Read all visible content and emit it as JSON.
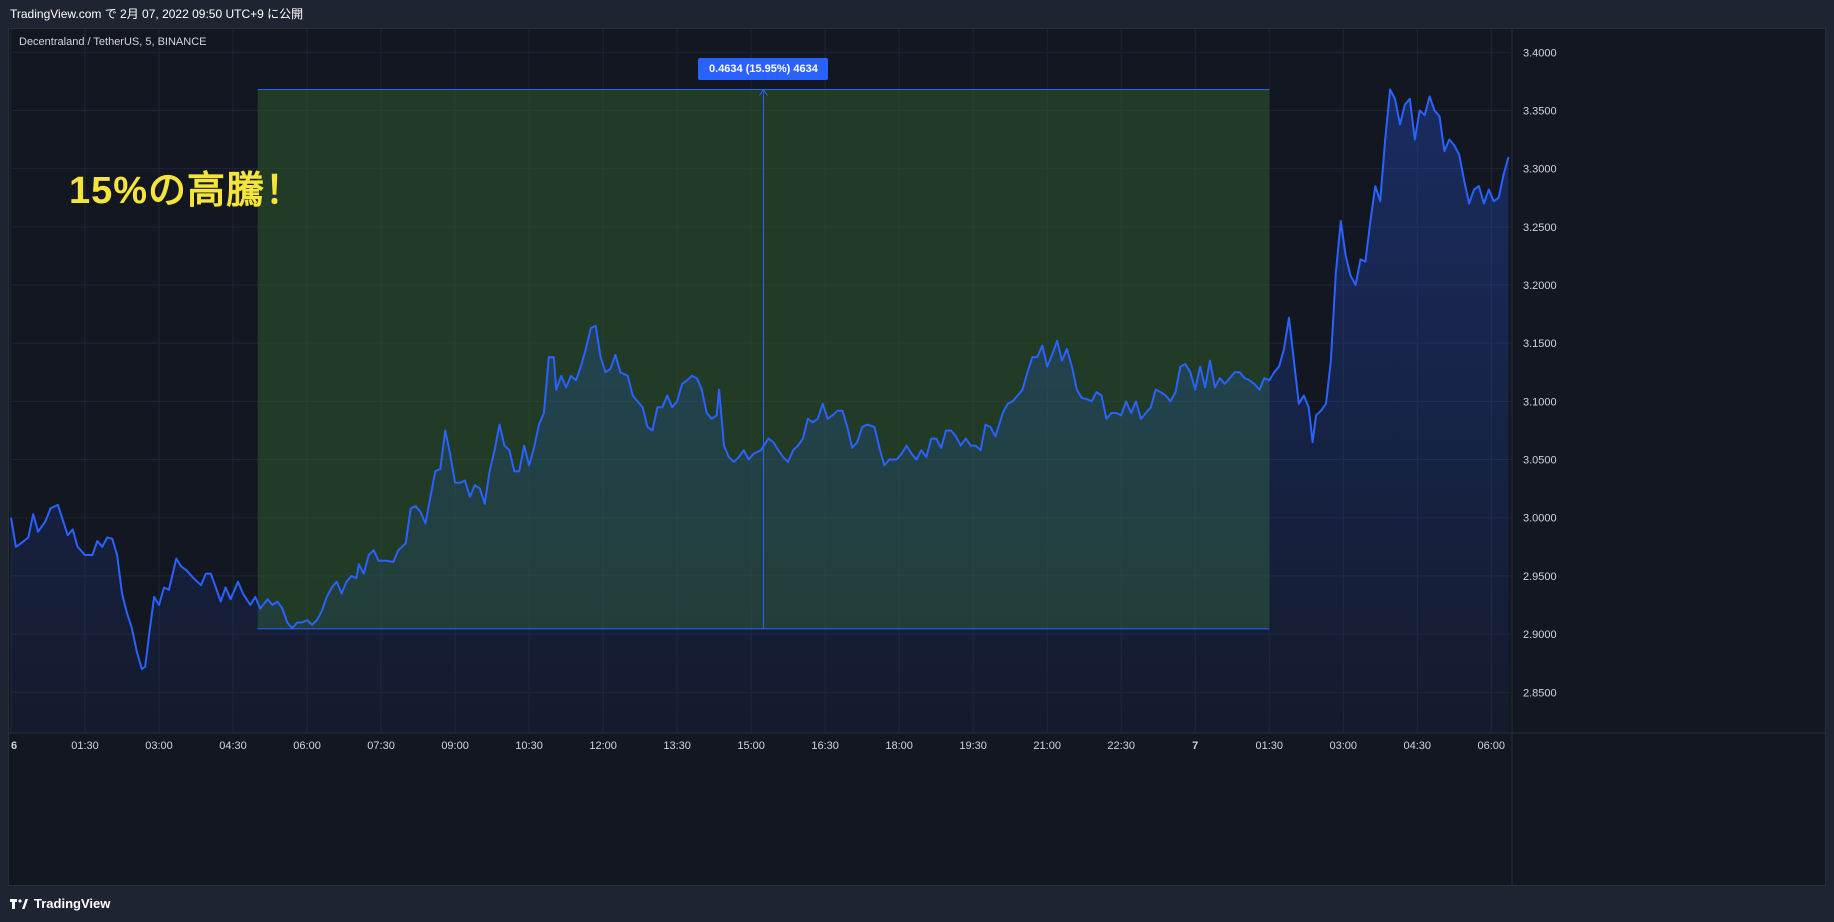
{
  "header": {
    "published": "TradingView.com で 2月 07, 2022 09:50 UTC+9 に公開"
  },
  "chart": {
    "symbol": "Decentraland / TetherUS, 5, BINANCE",
    "annotation": "15%の高騰！",
    "measure_label": "0.4634 (15.95%) 4634",
    "colors": {
      "line": "#2962ff",
      "area_fill": "#2962ff",
      "measure_fill": "#2e5a2a",
      "measure_border": "#2962ff",
      "background": "#131722",
      "grid": "#1f2535",
      "text": "#d1d4dc",
      "annotation": "#f5e43a"
    }
  },
  "chart_data": {
    "type": "area",
    "y_ticks": [
      "3.4000",
      "3.3500",
      "3.3000",
      "3.2500",
      "3.2000",
      "3.1500",
      "3.1000",
      "3.0500",
      "3.0000",
      "2.9500",
      "2.9000",
      "2.8500"
    ],
    "x_ticks": [
      "6",
      "01:30",
      "03:00",
      "04:30",
      "06:00",
      "07:30",
      "09:00",
      "10:30",
      "12:00",
      "13:30",
      "15:00",
      "16:30",
      "18:00",
      "19:30",
      "21:00",
      "22:30",
      "7",
      "01:30",
      "03:00",
      "04:30",
      "06:00"
    ],
    "ylim": [
      2.815,
      3.42
    ],
    "x_range_hours": [
      0,
      30.4
    ],
    "measure": {
      "x_start_hours": 5.0,
      "x_end_hours": 25.5,
      "y_low": 2.9045,
      "y_high": 3.368
    },
    "series": [
      {
        "values": [
          [
            0.0,
            3.0
          ],
          [
            0.1,
            2.975
          ],
          [
            0.2,
            2.978
          ],
          [
            0.35,
            2.983
          ],
          [
            0.45,
            3.003
          ],
          [
            0.55,
            2.988
          ],
          [
            0.7,
            2.997
          ],
          [
            0.8,
            3.008
          ],
          [
            0.95,
            3.011
          ],
          [
            1.05,
            2.998
          ],
          [
            1.15,
            2.985
          ],
          [
            1.25,
            2.99
          ],
          [
            1.35,
            2.975
          ],
          [
            1.5,
            2.968
          ],
          [
            1.65,
            2.968
          ],
          [
            1.75,
            2.98
          ],
          [
            1.85,
            2.975
          ],
          [
            1.95,
            2.983
          ],
          [
            2.05,
            2.982
          ],
          [
            2.15,
            2.968
          ],
          [
            2.25,
            2.935
          ],
          [
            2.35,
            2.918
          ],
          [
            2.45,
            2.905
          ],
          [
            2.55,
            2.885
          ],
          [
            2.65,
            2.87
          ],
          [
            2.72,
            2.872
          ],
          [
            2.8,
            2.9
          ],
          [
            2.9,
            2.932
          ],
          [
            3.0,
            2.925
          ],
          [
            3.1,
            2.94
          ],
          [
            3.2,
            2.938
          ],
          [
            3.35,
            2.965
          ],
          [
            3.45,
            2.958
          ],
          [
            3.55,
            2.955
          ],
          [
            3.7,
            2.948
          ],
          [
            3.85,
            2.942
          ],
          [
            3.95,
            2.952
          ],
          [
            4.05,
            2.952
          ],
          [
            4.15,
            2.94
          ],
          [
            4.25,
            2.928
          ],
          [
            4.35,
            2.94
          ],
          [
            4.45,
            2.93
          ],
          [
            4.6,
            2.945
          ],
          [
            4.7,
            2.935
          ],
          [
            4.85,
            2.925
          ],
          [
            4.95,
            2.932
          ],
          [
            5.05,
            2.922
          ],
          [
            5.2,
            2.93
          ],
          [
            5.3,
            2.925
          ],
          [
            5.4,
            2.928
          ],
          [
            5.5,
            2.922
          ],
          [
            5.6,
            2.91
          ],
          [
            5.7,
            2.905
          ],
          [
            5.8,
            2.91
          ],
          [
            5.9,
            2.91
          ],
          [
            6.0,
            2.912
          ],
          [
            6.1,
            2.908
          ],
          [
            6.2,
            2.912
          ],
          [
            6.3,
            2.92
          ],
          [
            6.4,
            2.932
          ],
          [
            6.5,
            2.94
          ],
          [
            6.6,
            2.945
          ],
          [
            6.7,
            2.935
          ],
          [
            6.8,
            2.945
          ],
          [
            6.9,
            2.95
          ],
          [
            7.0,
            2.948
          ],
          [
            7.05,
            2.96
          ],
          [
            7.15,
            2.952
          ],
          [
            7.25,
            2.968
          ],
          [
            7.35,
            2.972
          ],
          [
            7.45,
            2.963
          ],
          [
            7.6,
            2.963
          ],
          [
            7.75,
            2.962
          ],
          [
            7.85,
            2.972
          ],
          [
            8.0,
            2.978
          ],
          [
            8.1,
            3.008
          ],
          [
            8.2,
            3.01
          ],
          [
            8.3,
            3.005
          ],
          [
            8.4,
            2.995
          ],
          [
            8.5,
            3.018
          ],
          [
            8.6,
            3.04
          ],
          [
            8.7,
            3.042
          ],
          [
            8.8,
            3.075
          ],
          [
            8.9,
            3.055
          ],
          [
            9.0,
            3.03
          ],
          [
            9.1,
            3.03
          ],
          [
            9.2,
            3.032
          ],
          [
            9.3,
            3.018
          ],
          [
            9.4,
            3.028
          ],
          [
            9.5,
            3.025
          ],
          [
            9.6,
            3.012
          ],
          [
            9.7,
            3.04
          ],
          [
            9.8,
            3.058
          ],
          [
            9.9,
            3.08
          ],
          [
            10.0,
            3.062
          ],
          [
            10.1,
            3.058
          ],
          [
            10.2,
            3.04
          ],
          [
            10.3,
            3.04
          ],
          [
            10.4,
            3.062
          ],
          [
            10.5,
            3.045
          ],
          [
            10.6,
            3.06
          ],
          [
            10.7,
            3.08
          ],
          [
            10.8,
            3.09
          ],
          [
            10.9,
            3.138
          ],
          [
            11.0,
            3.138
          ],
          [
            11.05,
            3.11
          ],
          [
            11.15,
            3.122
          ],
          [
            11.25,
            3.112
          ],
          [
            11.35,
            3.122
          ],
          [
            11.45,
            3.118
          ],
          [
            11.55,
            3.13
          ],
          [
            11.65,
            3.145
          ],
          [
            11.75,
            3.163
          ],
          [
            11.85,
            3.165
          ],
          [
            11.95,
            3.138
          ],
          [
            12.05,
            3.125
          ],
          [
            12.15,
            3.128
          ],
          [
            12.25,
            3.14
          ],
          [
            12.35,
            3.125
          ],
          [
            12.5,
            3.122
          ],
          [
            12.6,
            3.105
          ],
          [
            12.7,
            3.1
          ],
          [
            12.8,
            3.095
          ],
          [
            12.9,
            3.078
          ],
          [
            13.0,
            3.075
          ],
          [
            13.1,
            3.095
          ],
          [
            13.2,
            3.095
          ],
          [
            13.3,
            3.105
          ],
          [
            13.4,
            3.095
          ],
          [
            13.5,
            3.1
          ],
          [
            13.6,
            3.115
          ],
          [
            13.7,
            3.118
          ],
          [
            13.8,
            3.122
          ],
          [
            13.9,
            3.12
          ],
          [
            14.0,
            3.11
          ],
          [
            14.1,
            3.09
          ],
          [
            14.2,
            3.085
          ],
          [
            14.3,
            3.088
          ],
          [
            14.35,
            3.11
          ],
          [
            14.45,
            3.062
          ],
          [
            14.55,
            3.052
          ],
          [
            14.65,
            3.048
          ],
          [
            14.75,
            3.052
          ],
          [
            14.85,
            3.058
          ],
          [
            14.95,
            3.05
          ],
          [
            15.05,
            3.055
          ],
          [
            15.2,
            3.058
          ],
          [
            15.35,
            3.068
          ],
          [
            15.45,
            3.065
          ],
          [
            15.55,
            3.058
          ],
          [
            15.65,
            3.052
          ],
          [
            15.75,
            3.048
          ],
          [
            15.85,
            3.058
          ],
          [
            15.95,
            3.062
          ],
          [
            16.05,
            3.068
          ],
          [
            16.15,
            3.085
          ],
          [
            16.25,
            3.082
          ],
          [
            16.35,
            3.085
          ],
          [
            16.45,
            3.098
          ],
          [
            16.55,
            3.085
          ],
          [
            16.65,
            3.088
          ],
          [
            16.75,
            3.092
          ],
          [
            16.85,
            3.092
          ],
          [
            16.95,
            3.078
          ],
          [
            17.05,
            3.06
          ],
          [
            17.15,
            3.065
          ],
          [
            17.25,
            3.078
          ],
          [
            17.35,
            3.08
          ],
          [
            17.5,
            3.078
          ],
          [
            17.6,
            3.06
          ],
          [
            17.7,
            3.045
          ],
          [
            17.8,
            3.05
          ],
          [
            17.95,
            3.05
          ],
          [
            18.05,
            3.055
          ],
          [
            18.15,
            3.062
          ],
          [
            18.25,
            3.055
          ],
          [
            18.35,
            3.05
          ],
          [
            18.45,
            3.058
          ],
          [
            18.55,
            3.052
          ],
          [
            18.65,
            3.068
          ],
          [
            18.75,
            3.068
          ],
          [
            18.85,
            3.06
          ],
          [
            18.95,
            3.075
          ],
          [
            19.05,
            3.075
          ],
          [
            19.15,
            3.07
          ],
          [
            19.25,
            3.062
          ],
          [
            19.35,
            3.068
          ],
          [
            19.45,
            3.062
          ],
          [
            19.55,
            3.062
          ],
          [
            19.65,
            3.058
          ],
          [
            19.75,
            3.08
          ],
          [
            19.85,
            3.078
          ],
          [
            19.95,
            3.07
          ],
          [
            20.1,
            3.09
          ],
          [
            20.2,
            3.098
          ],
          [
            20.3,
            3.1
          ],
          [
            20.4,
            3.105
          ],
          [
            20.5,
            3.11
          ],
          [
            20.6,
            3.125
          ],
          [
            20.7,
            3.138
          ],
          [
            20.8,
            3.138
          ],
          [
            20.9,
            3.148
          ],
          [
            21.0,
            3.13
          ],
          [
            21.1,
            3.14
          ],
          [
            21.2,
            3.152
          ],
          [
            21.3,
            3.135
          ],
          [
            21.4,
            3.145
          ],
          [
            21.5,
            3.13
          ],
          [
            21.6,
            3.11
          ],
          [
            21.7,
            3.103
          ],
          [
            21.8,
            3.102
          ],
          [
            21.9,
            3.1
          ],
          [
            22.0,
            3.108
          ],
          [
            22.1,
            3.105
          ],
          [
            22.2,
            3.085
          ],
          [
            22.3,
            3.09
          ],
          [
            22.4,
            3.09
          ],
          [
            22.5,
            3.088
          ],
          [
            22.6,
            3.1
          ],
          [
            22.7,
            3.09
          ],
          [
            22.8,
            3.1
          ],
          [
            22.9,
            3.085
          ],
          [
            23.0,
            3.09
          ],
          [
            23.1,
            3.095
          ],
          [
            23.2,
            3.11
          ],
          [
            23.3,
            3.108
          ],
          [
            23.4,
            3.105
          ],
          [
            23.5,
            3.1
          ],
          [
            23.6,
            3.108
          ],
          [
            23.7,
            3.13
          ],
          [
            23.8,
            3.132
          ],
          [
            23.9,
            3.125
          ],
          [
            24.0,
            3.11
          ],
          [
            24.1,
            3.13
          ],
          [
            24.2,
            3.112
          ],
          [
            24.3,
            3.135
          ],
          [
            24.4,
            3.112
          ],
          [
            24.5,
            3.12
          ],
          [
            24.6,
            3.115
          ],
          [
            24.7,
            3.12
          ],
          [
            24.8,
            3.125
          ],
          [
            24.9,
            3.125
          ],
          [
            25.0,
            3.12
          ],
          [
            25.1,
            3.118
          ],
          [
            25.2,
            3.115
          ],
          [
            25.3,
            3.11
          ],
          [
            25.4,
            3.12
          ],
          [
            25.5,
            3.118
          ],
          [
            25.6,
            3.125
          ],
          [
            25.7,
            3.13
          ],
          [
            25.8,
            3.145
          ],
          [
            25.9,
            3.172
          ],
          [
            26.0,
            3.135
          ],
          [
            26.1,
            3.098
          ],
          [
            26.2,
            3.105
          ],
          [
            26.3,
            3.095
          ],
          [
            26.38,
            3.065
          ],
          [
            26.45,
            3.088
          ],
          [
            26.55,
            3.092
          ],
          [
            26.65,
            3.098
          ],
          [
            26.75,
            3.135
          ],
          [
            26.85,
            3.21
          ],
          [
            26.95,
            3.255
          ],
          [
            27.05,
            3.225
          ],
          [
            27.15,
            3.208
          ],
          [
            27.25,
            3.2
          ],
          [
            27.35,
            3.222
          ],
          [
            27.45,
            3.22
          ],
          [
            27.55,
            3.255
          ],
          [
            27.65,
            3.285
          ],
          [
            27.75,
            3.272
          ],
          [
            27.85,
            3.325
          ],
          [
            27.95,
            3.368
          ],
          [
            28.05,
            3.36
          ],
          [
            28.15,
            3.338
          ],
          [
            28.25,
            3.355
          ],
          [
            28.35,
            3.36
          ],
          [
            28.45,
            3.325
          ],
          [
            28.55,
            3.35
          ],
          [
            28.65,
            3.346
          ],
          [
            28.75,
            3.362
          ],
          [
            28.85,
            3.35
          ],
          [
            28.95,
            3.345
          ],
          [
            29.05,
            3.315
          ],
          [
            29.15,
            3.325
          ],
          [
            29.25,
            3.32
          ],
          [
            29.35,
            3.312
          ],
          [
            29.45,
            3.29
          ],
          [
            29.55,
            3.27
          ],
          [
            29.65,
            3.282
          ],
          [
            29.75,
            3.285
          ],
          [
            29.85,
            3.27
          ],
          [
            29.95,
            3.282
          ],
          [
            30.05,
            3.272
          ],
          [
            30.15,
            3.275
          ],
          [
            30.25,
            3.295
          ],
          [
            30.35,
            3.31
          ]
        ]
      }
    ]
  },
  "footer": {
    "brand": "TradingView"
  }
}
